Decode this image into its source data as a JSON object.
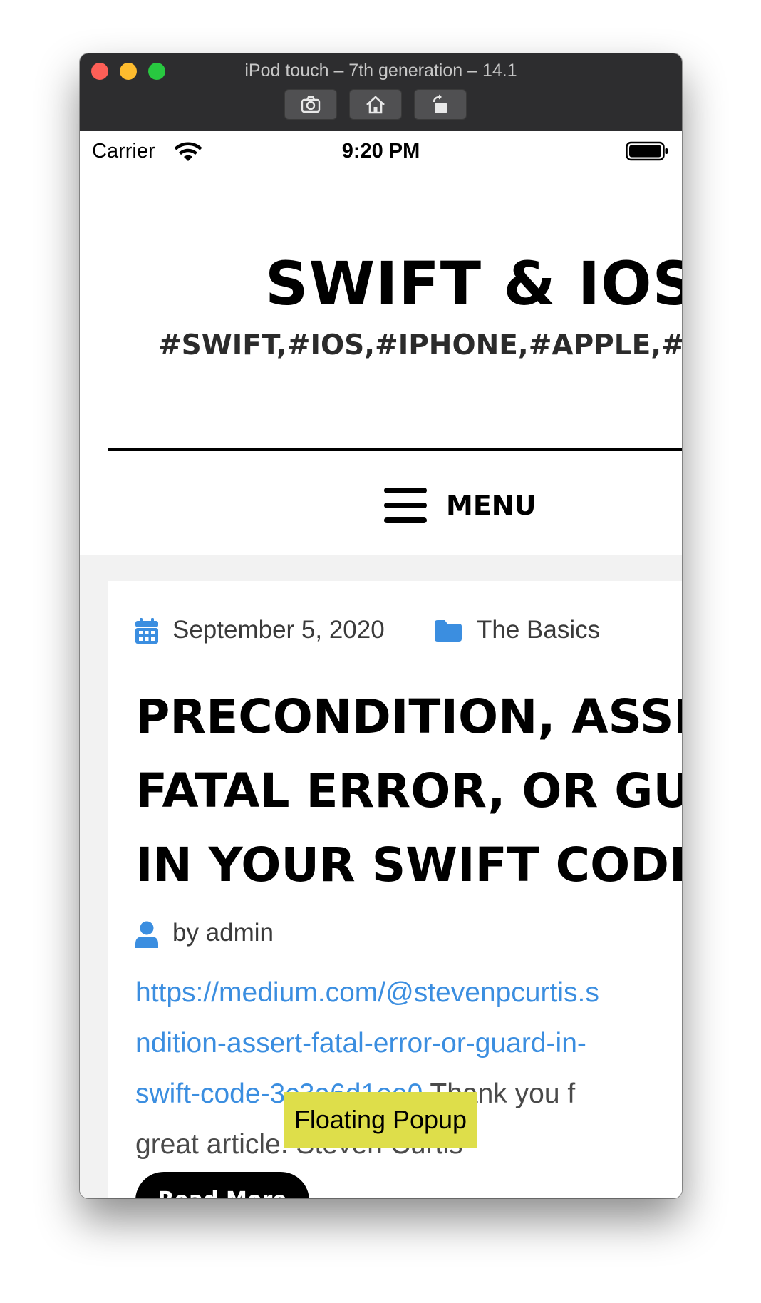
{
  "window": {
    "title": "iPod touch – 7th generation – 14.1",
    "buttons": [
      {
        "icon": "camera-icon",
        "label": "Screenshot"
      },
      {
        "icon": "home-icon",
        "label": "Home"
      },
      {
        "icon": "rotate-icon",
        "label": "Rotate"
      }
    ]
  },
  "status_bar": {
    "carrier": "Carrier",
    "time": "9:20 PM",
    "wifi_icon": "wifi-icon",
    "battery_icon": "battery-icon"
  },
  "site": {
    "title": "SWIFT & IOS",
    "tagline": "#SWIFT,#IOS,#IPHONE,#APPLE,#:"
  },
  "menu": {
    "label": "MENU",
    "icon": "hamburger-icon"
  },
  "post": {
    "date": "September 5, 2020",
    "category": "The Basics",
    "title_lines": [
      "PRECONDITION, ASSE",
      "FATAL ERROR, OR GU/",
      "IN YOUR SWIFT CODE"
    ],
    "author": "by admin",
    "excerpt": {
      "link_line1": "https://medium.com/@stevenpcurtis.s",
      "link_line2": "ndition-assert-fatal-error-or-guard-in-",
      "link_line3_start": "swift-code",
      "link_line3_hidden": "-3c3a6d1e",
      "link_line3_end": "e0",
      "text_line3": " Thank you f",
      "text_line4": "great article. Steven Curtis"
    },
    "read_more": "Read More"
  },
  "popup": {
    "label": "Floating Popup"
  },
  "colors": {
    "accent": "#3b8ee0",
    "popup": "#dede4a",
    "titlebar": "#2d2d2f"
  }
}
